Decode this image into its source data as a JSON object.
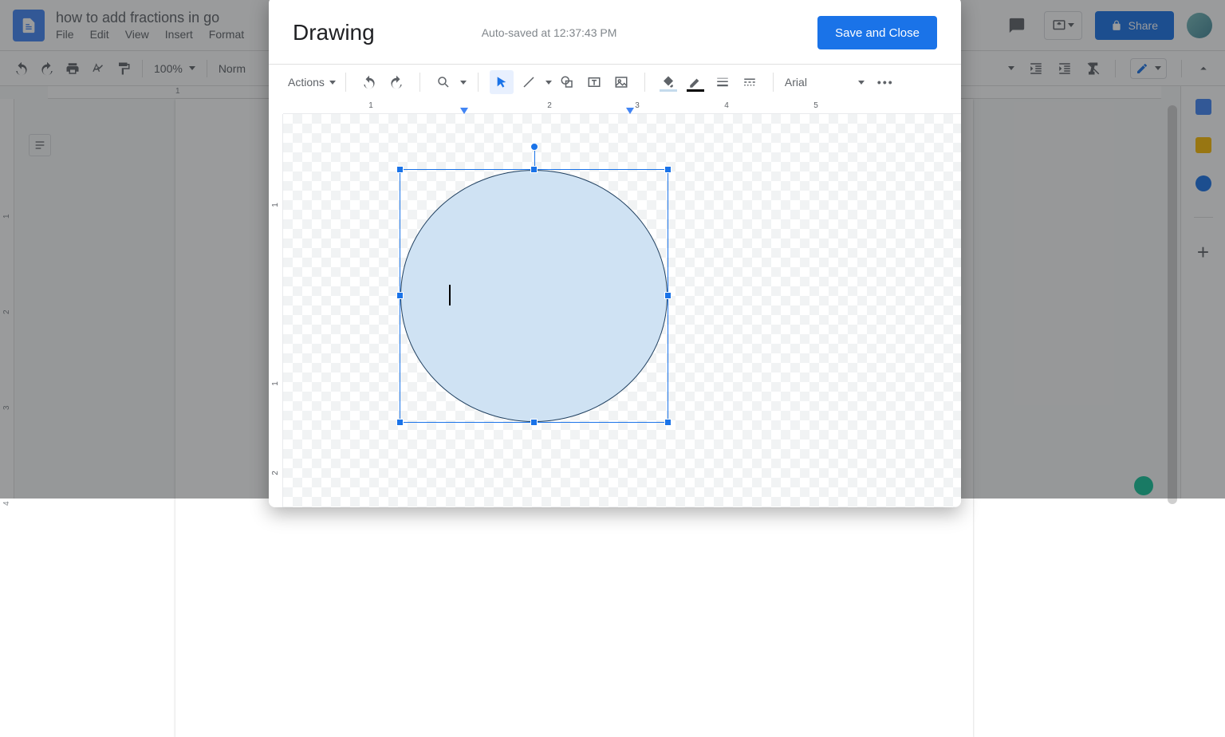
{
  "docs": {
    "title": "how to add fractions in go",
    "menus": [
      "File",
      "Edit",
      "View",
      "Insert",
      "Format"
    ],
    "share": "Share",
    "zoom": "100%",
    "style": "Norm",
    "v_ruler_top": "1",
    "v_ruler": [
      "1",
      "2",
      "3",
      "4"
    ]
  },
  "dialog": {
    "title": "Drawing",
    "status": "Auto-saved at 12:37:43 PM",
    "save": "Save and Close",
    "actions": "Actions",
    "font": "Arial",
    "h_ruler": [
      "1",
      "2",
      "3",
      "4",
      "5"
    ],
    "v_ruler": [
      "1",
      "1",
      "2"
    ]
  }
}
